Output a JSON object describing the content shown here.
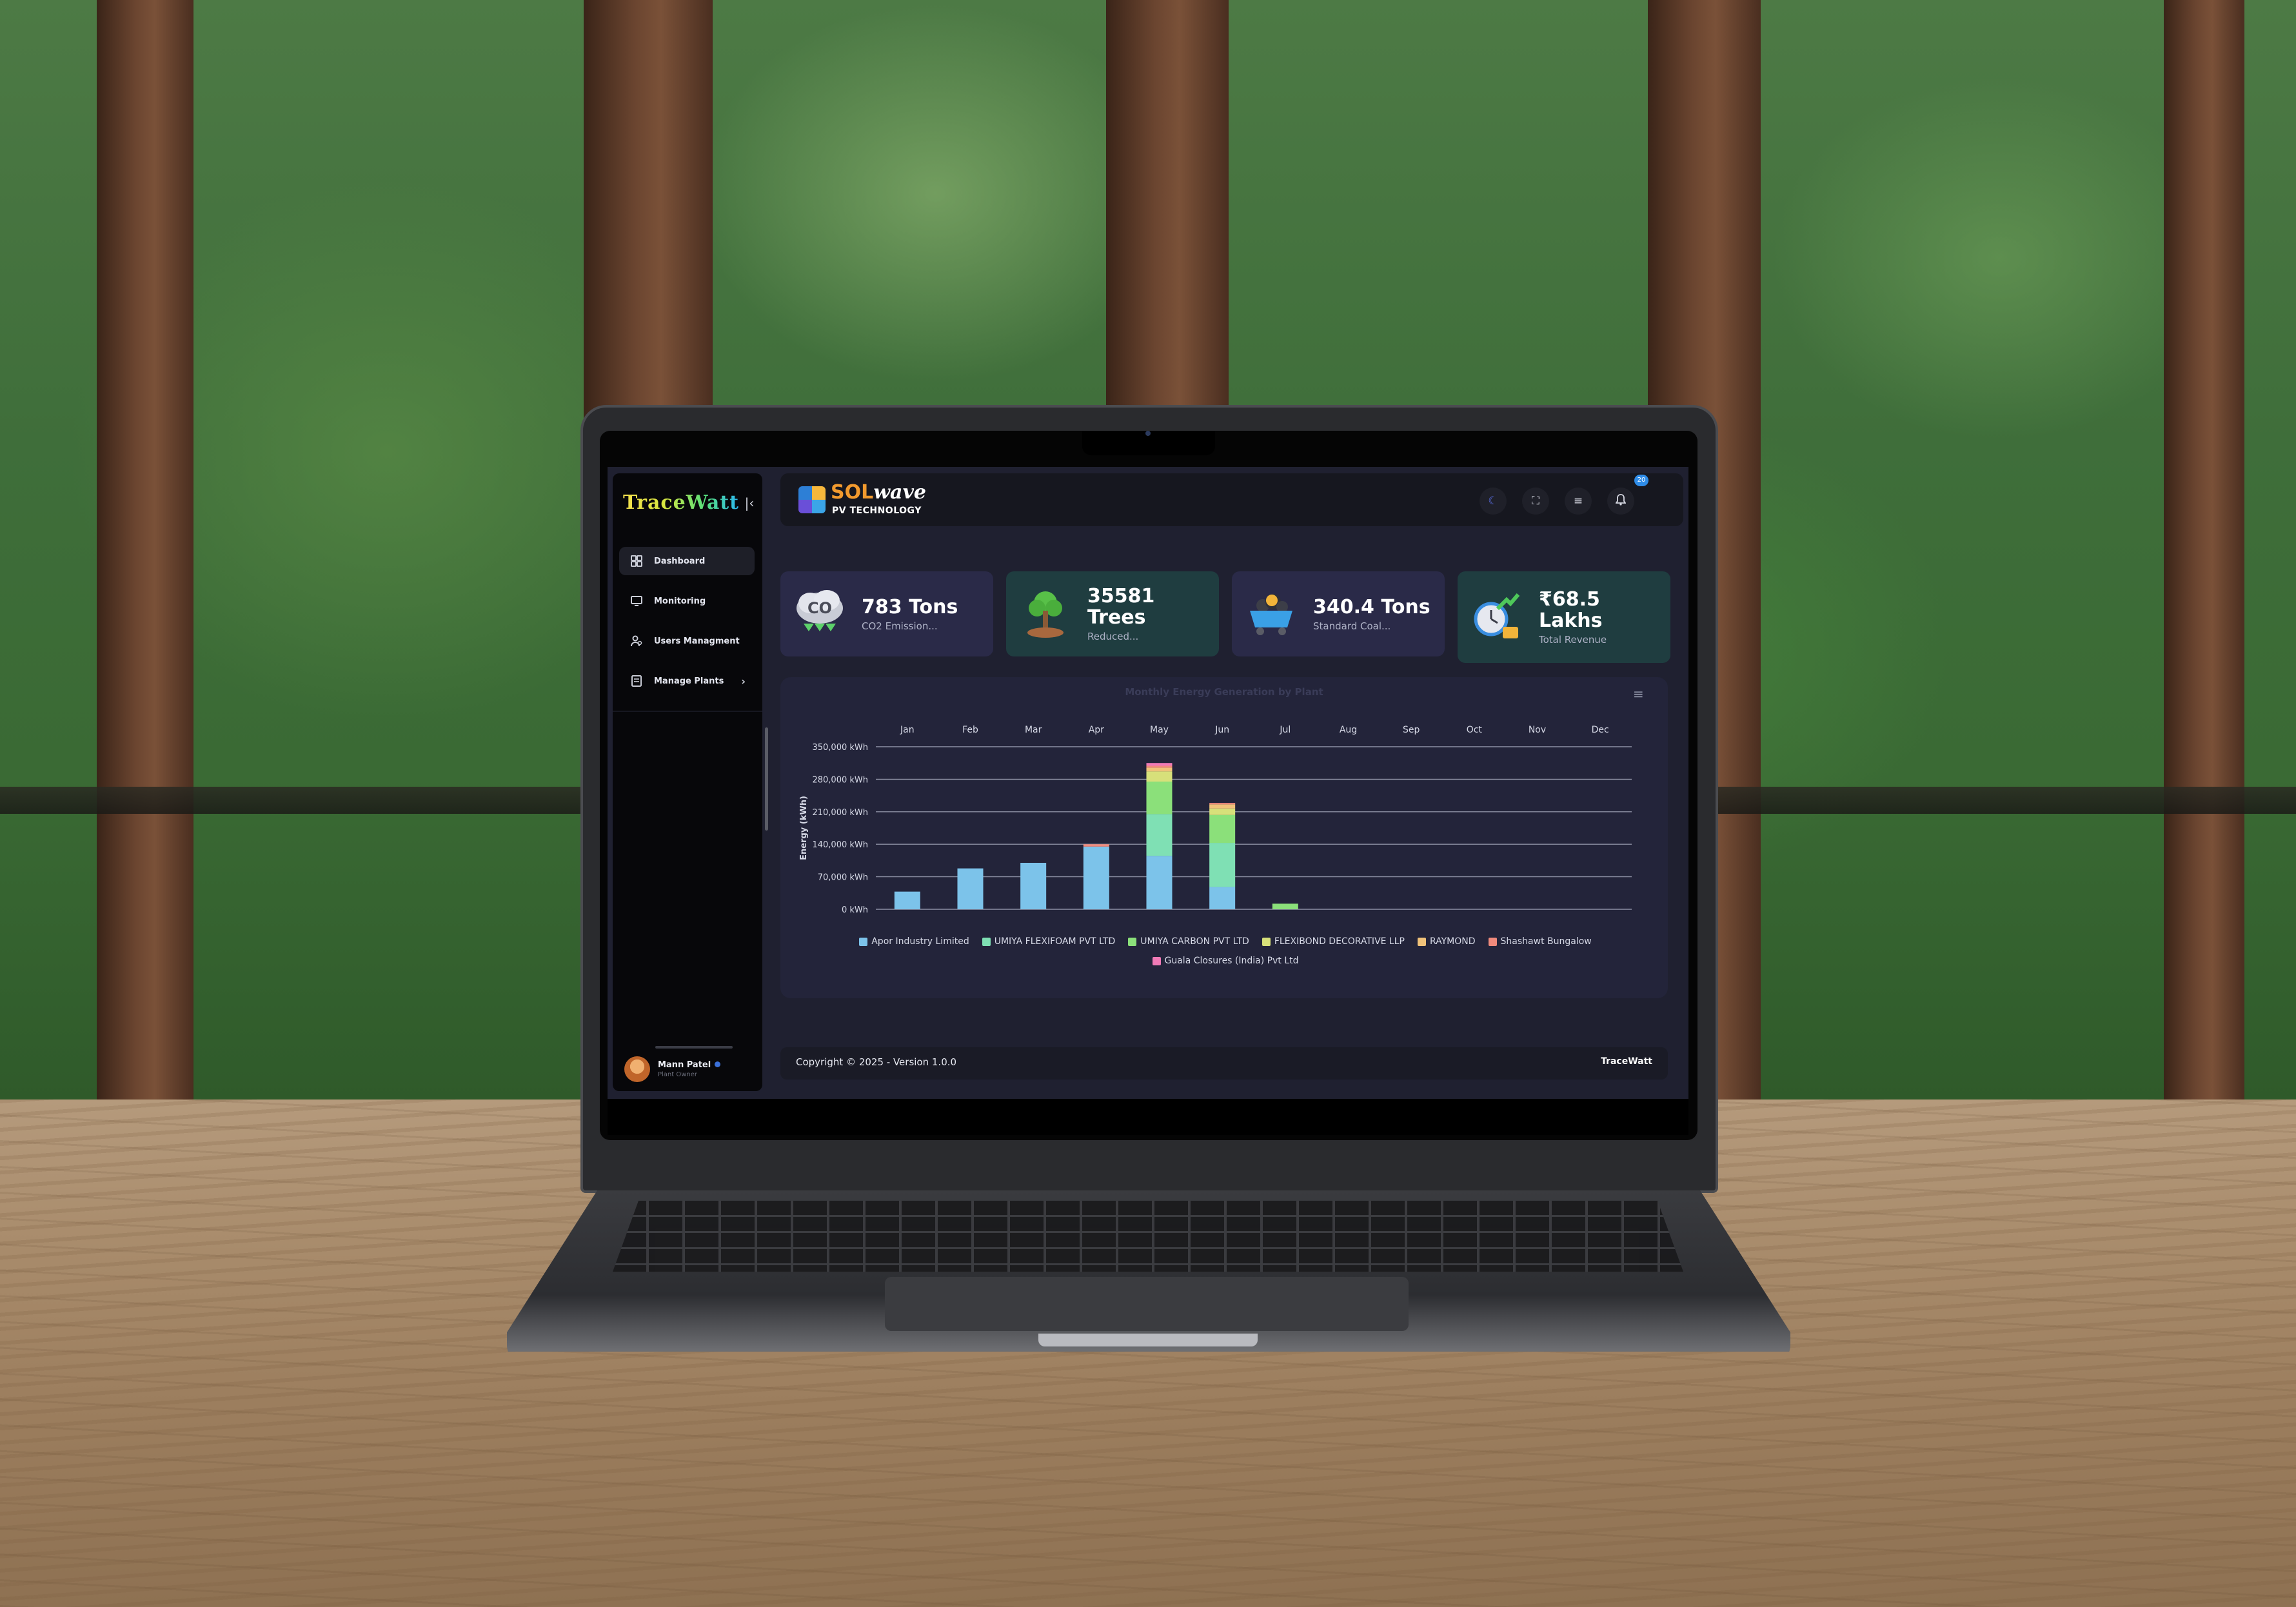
{
  "sidebar": {
    "brand": "TraceWatt",
    "collapse_icon": "collapse-left-icon",
    "items": [
      {
        "label": "Dashboard",
        "icon": "grid-icon",
        "active": true
      },
      {
        "label": "Monitoring",
        "icon": "monitor-icon",
        "active": false
      },
      {
        "label": "Users Managment",
        "icon": "users-icon",
        "active": false
      },
      {
        "label": "Manage Plants",
        "icon": "document-icon",
        "active": false,
        "has_submenu": true
      }
    ],
    "user": {
      "name": "Mann Patel",
      "role": "Plant Owner"
    }
  },
  "header": {
    "logo_sol": "SOL",
    "logo_wave": "wave",
    "logo_sub": "PV TECHNOLOGY",
    "actions": [
      "moon-icon",
      "fullscreen-icon",
      "settings-sliders-icon",
      "bell-icon"
    ],
    "notification_count": "20"
  },
  "stats": [
    {
      "value": "783 Tons",
      "label": "CO2 Emission...",
      "icon": "co2-cloud-icon",
      "bg": "#2a2a48"
    },
    {
      "value": "35581 Trees",
      "label": "Reduced...",
      "icon": "tree-icon",
      "bg": "#1f3d40"
    },
    {
      "value": "340.4 Tons",
      "label": "Standard Coal...",
      "icon": "coal-cart-icon",
      "bg": "#2a2a48"
    },
    {
      "value": "₹68.5",
      "value2": "Lakhs",
      "label": "Total Revenue",
      "icon": "revenue-clock-icon",
      "bg": "#1f3d40"
    }
  ],
  "chart_data": {
    "type": "bar",
    "stacked": true,
    "title": "Monthly Energy Generation by Plant",
    "ylabel": "Energy (kWh)",
    "ylim": [
      0,
      350000
    ],
    "yticks": [
      "0 kWh",
      "70,000 kWh",
      "140,000 kWh",
      "210,000 kWh",
      "280,000 kWh",
      "350,000 kWh"
    ],
    "categories": [
      "Jan",
      "Feb",
      "Mar",
      "Apr",
      "May",
      "Jun",
      "Jul",
      "Aug",
      "Sep",
      "Oct",
      "Nov",
      "Dec"
    ],
    "series": [
      {
        "name": "Apor Industry Limited",
        "color": "#7cc3ea",
        "values": [
          38000,
          88000,
          100000,
          135000,
          115000,
          48000,
          0,
          0,
          0,
          0,
          0,
          0
        ]
      },
      {
        "name": "UMIYA FLEXIFOAM PVT LTD",
        "color": "#7fe0b4",
        "values": [
          0,
          0,
          0,
          0,
          90000,
          95000,
          0,
          0,
          0,
          0,
          0,
          0
        ]
      },
      {
        "name": "UMIYA CARBON PVT LTD",
        "color": "#8be07a",
        "values": [
          0,
          0,
          0,
          0,
          70000,
          60000,
          12000,
          0,
          0,
          0,
          0,
          0
        ]
      },
      {
        "name": "FLEXIBOND DECORATIVE LLP",
        "color": "#d7e07a",
        "values": [
          0,
          0,
          0,
          0,
          22000,
          14000,
          0,
          0,
          0,
          0,
          0,
          0
        ]
      },
      {
        "name": "RAYMOND",
        "color": "#f0c27a",
        "values": [
          0,
          0,
          0,
          0,
          8000,
          9000,
          0,
          0,
          0,
          0,
          0,
          0
        ]
      },
      {
        "name": "Shashawt Bungalow",
        "color": "#f08a7c",
        "values": [
          0,
          0,
          0,
          5000,
          4000,
          3000,
          0,
          0,
          0,
          0,
          0,
          0
        ]
      },
      {
        "name": "Guala Closures (India) Pvt Ltd",
        "color": "#f07ab6",
        "values": [
          0,
          0,
          0,
          0,
          6000,
          0,
          0,
          0,
          0,
          0,
          0,
          0
        ]
      }
    ],
    "grid": true,
    "legend_position": "bottom"
  },
  "footer": {
    "copyright": "Copyright © 2025 - Version 1.0.0",
    "brand": "TraceWatt"
  }
}
